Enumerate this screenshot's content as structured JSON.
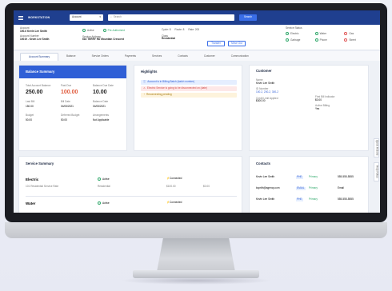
{
  "topbar": {
    "brand": "WORKSTATION",
    "select_value": "Account",
    "search_placeholder": "Search",
    "search_button": "Search"
  },
  "account": {
    "acct_label": "Account",
    "acct_value": "100-0 Kevin Lee Smith",
    "acct2_label": "Account Number",
    "acct2_value": "10019 - Kevin Lee Smith",
    "status1": "Active",
    "status2": "Pre-Authorized",
    "svc_addr_label": "Service Address",
    "svc_addr_value": "616 TERRY RD Mountain Crescent",
    "cycle_label": "Cycle: 8",
    "route_label": "Route: 8",
    "rate_label": "Rate: 200",
    "class_label": "Class",
    "class_value": "Residential",
    "transfer_button": "Transfer",
    "moveout_button": "Move Out",
    "service_status_title": "Service Status",
    "svc_items": [
      "Electric",
      "Water",
      "Gas",
      "Garbage",
      "Phone",
      "Street"
    ]
  },
  "tabs": [
    "Account Summary",
    "Balance",
    "Service Orders",
    "Payments",
    "Services",
    "Contacts",
    "Customer",
    "Communication"
  ],
  "balance": {
    "title": "Balance Summary",
    "labels": [
      "Total Account Balance",
      "Past Due",
      "Balance Due Date"
    ],
    "values": [
      "250.00",
      "100.00",
      "10.00"
    ],
    "rows": [
      [
        "Last Bill",
        "Bill Date",
        "Balance Date"
      ],
      [
        "150.00",
        "04/05/2021",
        "04/05/2021"
      ],
      [
        "Budget",
        "Deferred Budget",
        "Arrangements"
      ],
      [
        "50.00",
        "50.00",
        "Not Applicable"
      ]
    ]
  },
  "highlights": {
    "title": "Highlights",
    "items": [
      "Account is in Billing Batch (batch number)",
      "Electric Service is going to be disconnected on (date)",
      "Reconnecting pending"
    ]
  },
  "customer": {
    "title": "Customer",
    "name_label": "Name",
    "name_value": "Kevin Lee Smith",
    "id_label": "ID Number",
    "id_value": "100-2, 200-2, 300-2",
    "first_bill_label": "First Bill Indicator",
    "first_bill_value": "$0.00",
    "credit_label": "Credit Limit Applied",
    "credit_value": "$300.00",
    "active_label": "Active Billing",
    "active_value": "Yes"
  },
  "service_summary": {
    "title": "Service Summary",
    "services": [
      {
        "name": "Electric",
        "status": "Active",
        "connected": "Connected",
        "desc": "101 Residential Service Rate",
        "cat": "Residential",
        "deposit": "$100.00",
        "amount": "$0.00"
      },
      {
        "name": "Water",
        "status": "Active",
        "connected": "Connected",
        "desc": "",
        "cat": "",
        "deposit": "",
        "amount": ""
      }
    ]
  },
  "contacts": {
    "title": "Contacts",
    "rows": [
      {
        "name": "Kevin Lee Smith",
        "tag": "PHE",
        "tag2": "Primary",
        "phone": "555-555-5555"
      },
      {
        "name": "ksprith@agency.com",
        "tag": "EMAIL",
        "tag2": "Primary",
        "phone": "Email"
      },
      {
        "name": "Kevin Lee Smith",
        "tag": "PHE",
        "tag2": "Primary",
        "phone": "555-555-5555"
      }
    ]
  },
  "side_tabs": [
    "Quick Actions",
    "Help Notes"
  ],
  "colors": {
    "brand": "#1f3f8f",
    "accent": "#3a6ee8",
    "good": "#2fa86a",
    "warn": "#e05a3c"
  }
}
